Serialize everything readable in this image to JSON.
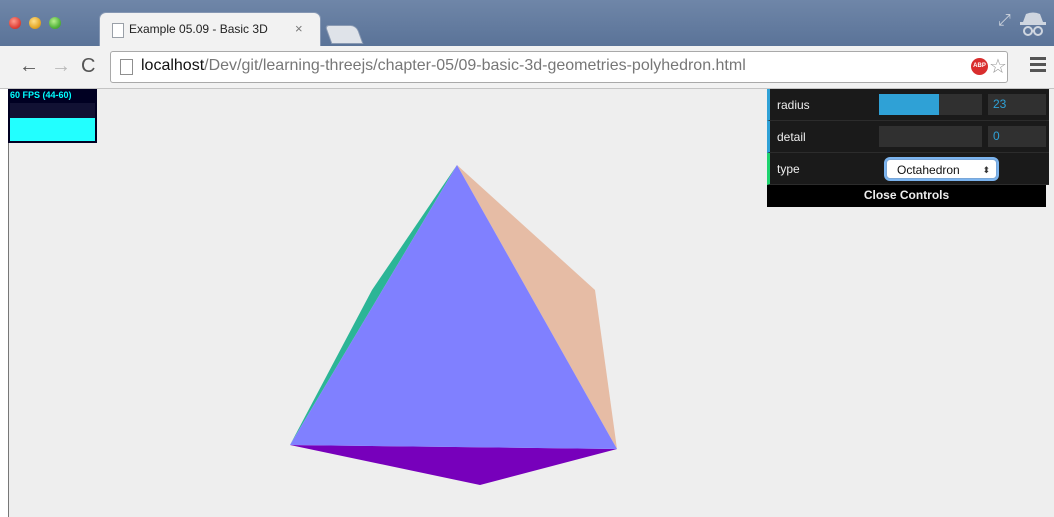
{
  "browser": {
    "tab": {
      "title": "Example 05.09 - Basic 3D",
      "title_fade": " ",
      "close": "×"
    },
    "address": {
      "host": "localhost",
      "path": "/Dev/git/learning-threejs/chapter-05/09-basic-3d-geometries-polyhedron.html"
    },
    "abp_label": "ABP",
    "star_glyph": "☆"
  },
  "stats": {
    "fps_text": "60 FPS (44-60)"
  },
  "controls": {
    "radius": {
      "label": "radius",
      "value": "23",
      "fraction": 0.58
    },
    "detail": {
      "label": "detail",
      "value": "0",
      "fraction": 0.0
    },
    "type": {
      "label": "type",
      "selected": "Octahedron",
      "caret": "⬍"
    },
    "close_label": "Close Controls"
  },
  "colors": {
    "accent_number": "#2fa1d6",
    "accent_option": "#1ed36f",
    "face_front": "#8080ff",
    "face_right": "#e6bca5",
    "face_left": "#2bb596",
    "face_bottom": "#7700bb"
  }
}
